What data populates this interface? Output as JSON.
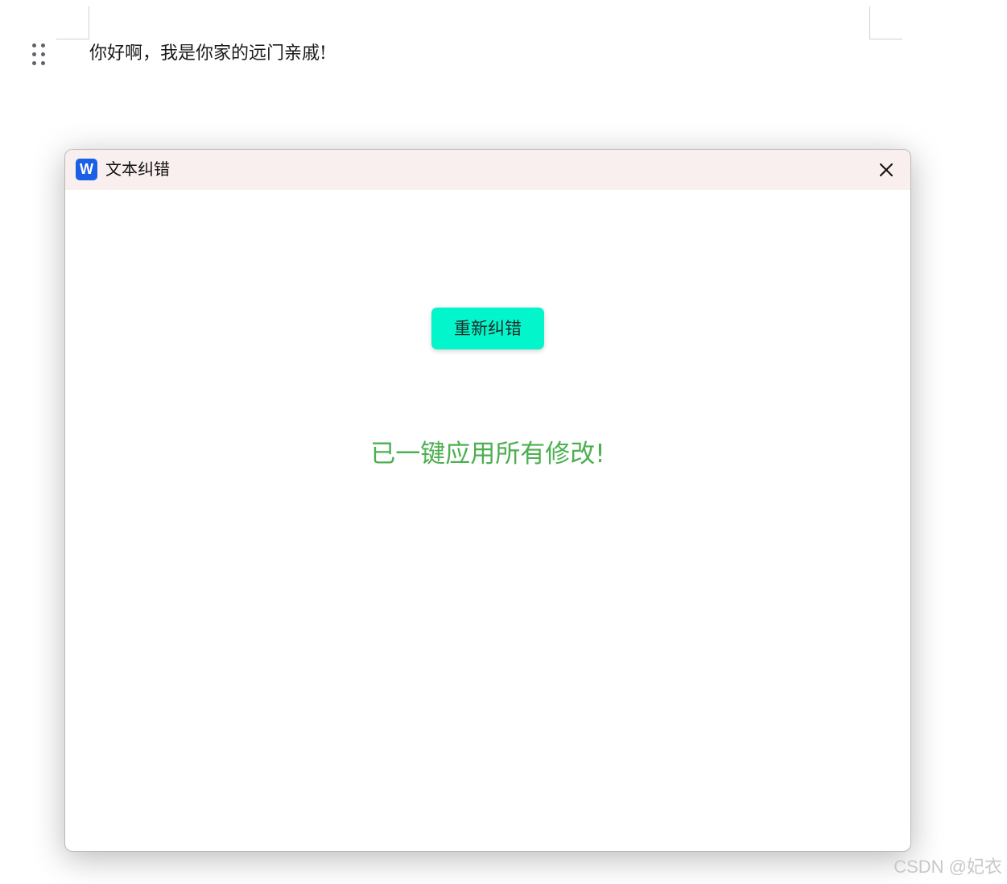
{
  "document": {
    "text": "你好啊，我是你家的远门亲戚!"
  },
  "dialog": {
    "app_icon": "W",
    "title": "文本纠错",
    "close_icon": "close-icon",
    "recheck_button_label": "重新纠错",
    "status_message": "已一键应用所有修改!",
    "colors": {
      "button_bg": "#03f5cb",
      "status_text": "#4caf50",
      "titlebar_bg": "#f8efee",
      "app_icon_bg": "#1a5fe6"
    }
  },
  "watermark": {
    "text": "CSDN @妃衣"
  }
}
